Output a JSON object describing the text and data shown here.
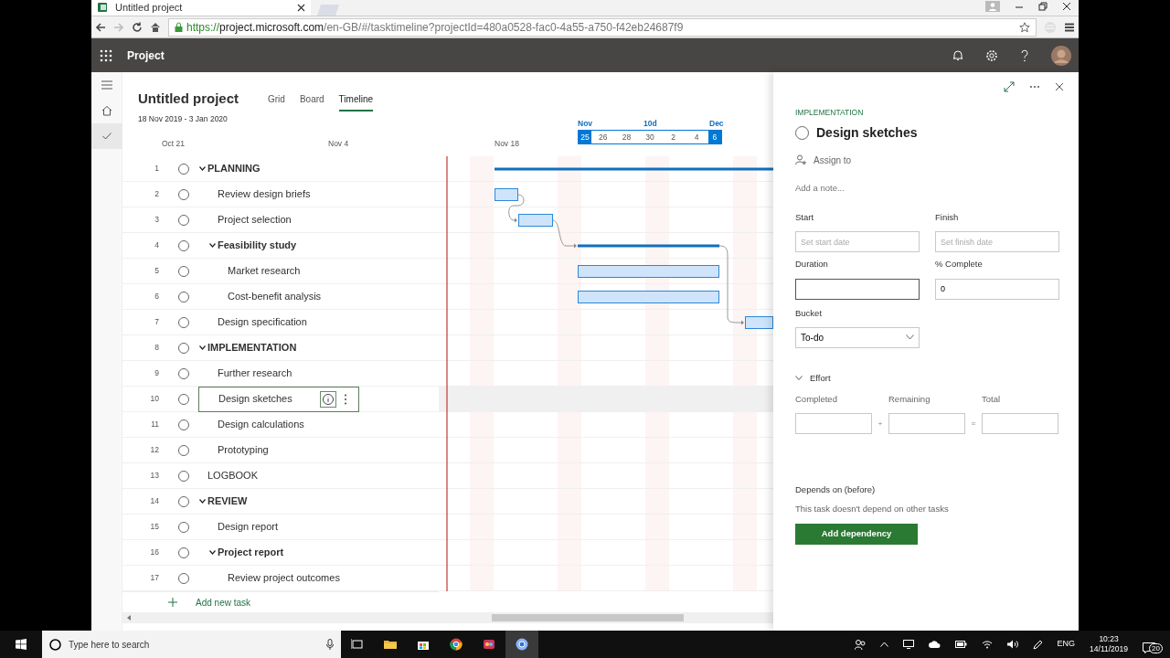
{
  "browser": {
    "tab_title": "Untitled project",
    "url_scheme": "https://",
    "url_host": "project.microsoft.com",
    "url_path": "/en-GB/#/tasktimeline?projectId=480a0528-fac0-4a55-a750-f42eb24687f9"
  },
  "app": {
    "name": "Project"
  },
  "rail": [
    {
      "kind": "home",
      "selected": false
    },
    {
      "kind": "check",
      "selected": true
    }
  ],
  "project": {
    "title": "Untitled project",
    "dates": "18 Nov 2019 - 3 Jan 2020"
  },
  "views": [
    {
      "label": "Grid",
      "selected": false
    },
    {
      "label": "Board",
      "selected": false
    },
    {
      "label": "Timeline",
      "selected": true
    }
  ],
  "timeline": {
    "labels": [
      "Oct 21",
      "Nov 4",
      "Nov 18"
    ],
    "range": {
      "start_label": "Nov",
      "span": "10d",
      "end_label": "Dec",
      "days": [
        {
          "label": "25",
          "selected": true
        },
        {
          "label": "26",
          "selected": false
        },
        {
          "label": "28",
          "selected": false
        },
        {
          "label": "30",
          "selected": false
        },
        {
          "label": "2",
          "selected": false
        },
        {
          "label": "4",
          "selected": false
        },
        {
          "label": "6",
          "selected": true
        }
      ]
    }
  },
  "tasks": [
    {
      "number": "1",
      "name": "PLANNING",
      "kind": "summary",
      "expanded": true,
      "checked": false,
      "selected": false,
      "children": [
        {
          "number": "2",
          "name": "Review design briefs",
          "kind": "task",
          "checked": false,
          "selected": false
        },
        {
          "number": "3",
          "name": "Project selection",
          "kind": "task",
          "checked": false,
          "selected": false
        },
        {
          "number": "4",
          "name": "Feasibility study",
          "kind": "summary",
          "expanded": true,
          "checked": false,
          "selected": false,
          "children": [
            {
              "number": "5",
              "name": "Market research",
              "kind": "task",
              "checked": false,
              "selected": false
            },
            {
              "number": "6",
              "name": "Cost-benefit analysis",
              "kind": "task",
              "checked": false,
              "selected": false
            }
          ]
        },
        {
          "number": "7",
          "name": "Design specification",
          "kind": "task",
          "checked": false,
          "selected": false
        }
      ]
    },
    {
      "number": "8",
      "name": "IMPLEMENTATION",
      "kind": "summary",
      "expanded": true,
      "checked": false,
      "selected": false,
      "children": [
        {
          "number": "9",
          "name": "Further research",
          "kind": "task",
          "checked": false,
          "selected": false
        },
        {
          "number": "10",
          "name": "Design sketches",
          "kind": "task",
          "checked": false,
          "selected": true
        },
        {
          "number": "11",
          "name": "Design calculations",
          "kind": "task",
          "checked": false,
          "selected": false
        },
        {
          "number": "12",
          "name": "Prototyping",
          "kind": "task",
          "checked": false,
          "selected": false
        }
      ]
    },
    {
      "number": "13",
      "name": "LOGBOOK",
      "kind": "task",
      "checked": false,
      "selected": false
    },
    {
      "number": "14",
      "name": "REVIEW",
      "kind": "summary",
      "expanded": true,
      "checked": false,
      "selected": false,
      "children": [
        {
          "number": "15",
          "name": "Design report",
          "kind": "task",
          "checked": false,
          "selected": false
        },
        {
          "number": "16",
          "name": "Project report",
          "kind": "summary",
          "expanded": true,
          "checked": false,
          "selected": false,
          "children": [
            {
              "number": "17",
              "name": "Review project outcomes",
              "kind": "task",
              "checked": false,
              "selected": false
            }
          ]
        }
      ]
    }
  ],
  "add_task": "Add new task",
  "panel": {
    "bucket_name": "IMPLEMENTATION",
    "title": "Design sketches",
    "checked": false,
    "assign": "Assign to",
    "note_placeholder": "Add a note...",
    "fields": [
      {
        "label": "Start",
        "placeholder": "Set start date"
      },
      {
        "label": "Finish",
        "placeholder": "Set finish date"
      },
      {
        "label": "Duration"
      },
      {
        "label": "% Complete",
        "value": "0"
      }
    ],
    "bucket": {
      "label": "Bucket",
      "value": "To-do"
    },
    "effort": {
      "label": "Effort",
      "expanded": true,
      "fields": [
        "Completed",
        "Remaining",
        "Total"
      ]
    },
    "depends": {
      "label": "Depends on (before)",
      "note": "This task doesn't depend on other tasks",
      "button": "Add dependency"
    }
  },
  "taskbar": {
    "search_placeholder": "Type here to search",
    "language": "ENG",
    "time": "10:23",
    "date": "14/11/2019",
    "notifications": "20"
  }
}
